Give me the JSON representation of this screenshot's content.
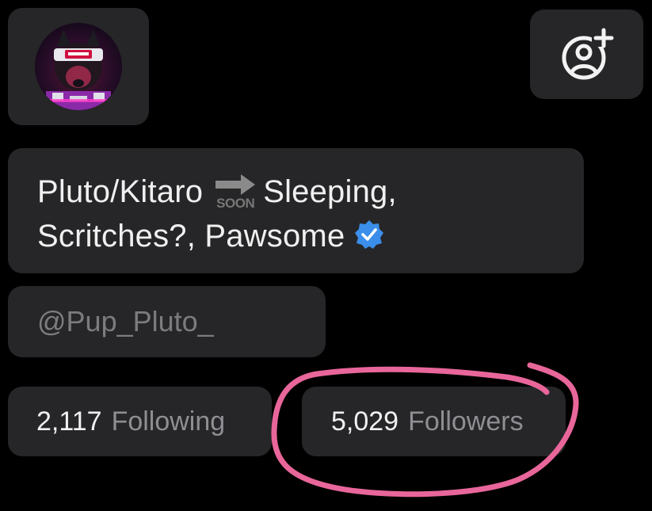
{
  "profile": {
    "avatar_icon": "profile-photo",
    "follow_icon": "person-add-icon",
    "name_part1": "Pluto/Kitaro",
    "soon_label": "SOON",
    "name_part2": "Sleeping,",
    "name_line2": "Scritches?, Pawsome",
    "verified_icon": "verified-badge-icon",
    "handle": "@Pup_Pluto_"
  },
  "stats": {
    "following_count": "2,117",
    "following_label": "Following",
    "followers_count": "5,029",
    "followers_label": "Followers"
  },
  "colors": {
    "background": "#000000",
    "card": "#262628",
    "text_primary": "#f0f0f0",
    "text_secondary": "#8e8e93",
    "verified_blue": "#3b8eea",
    "highlight_pink": "#e8669a"
  }
}
